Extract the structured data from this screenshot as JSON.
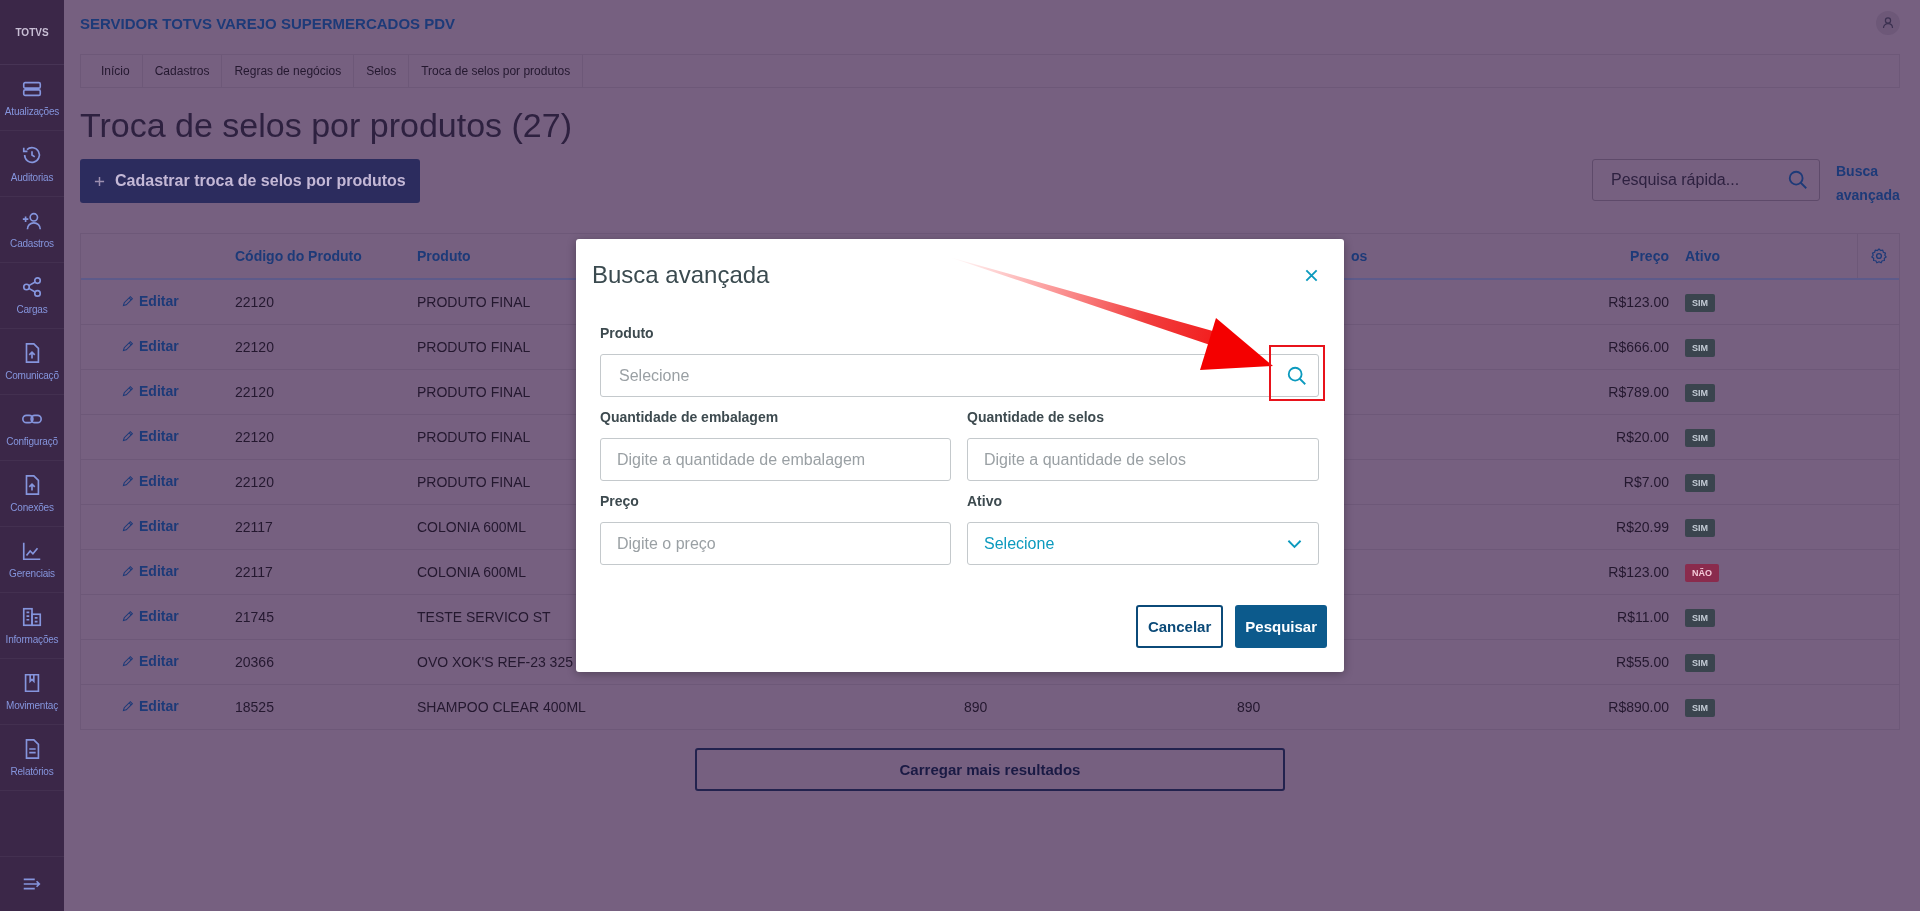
{
  "sidebar": {
    "logo": "TOTVS",
    "items": [
      {
        "label": "Atualizações"
      },
      {
        "label": "Auditorias"
      },
      {
        "label": "Cadastros"
      },
      {
        "label": "Cargas"
      },
      {
        "label": "Comunicaçõ"
      },
      {
        "label": "Configuraçõ"
      },
      {
        "label": "Conexões"
      },
      {
        "label": "Gerenciais"
      },
      {
        "label": "Informações"
      },
      {
        "label": "Movimentaç"
      },
      {
        "label": "Relatórios"
      }
    ]
  },
  "header": {
    "title": "SERVIDOR TOTVS VAREJO SUPERMERCADOS PDV"
  },
  "breadcrumb": [
    "Início",
    "Cadastros",
    "Regras de negócios",
    "Selos",
    "Troca de selos por produtos"
  ],
  "page_title": "Troca de selos por produtos (27)",
  "create_button": "Cadastrar troca de selos por produtos",
  "search": {
    "placeholder": "Pesquisa rápida...",
    "advanced_link": "Busca avançada"
  },
  "table": {
    "columns": {
      "code": "Código do Produto",
      "product": "Produto",
      "column_4": "os",
      "price": "Preço",
      "active": "Ativo"
    },
    "rows": [
      {
        "action": "Editar",
        "code": "22120",
        "product": "PRODUTO FINAL",
        "price": "R$123.00",
        "status": "SIM",
        "active": true
      },
      {
        "action": "Editar",
        "code": "22120",
        "product": "PRODUTO FINAL",
        "price": "R$666.00",
        "status": "SIM",
        "active": true
      },
      {
        "action": "Editar",
        "code": "22120",
        "product": "PRODUTO FINAL",
        "price": "R$789.00",
        "status": "SIM",
        "active": true
      },
      {
        "action": "Editar",
        "code": "22120",
        "product": "PRODUTO FINAL",
        "price": "R$20.00",
        "status": "SIM",
        "active": true
      },
      {
        "action": "Editar",
        "code": "22120",
        "product": "PRODUTO FINAL",
        "price": "R$7.00",
        "status": "SIM",
        "active": true
      },
      {
        "action": "Editar",
        "code": "22117",
        "product": "COLONIA 600ML",
        "price": "R$20.99",
        "status": "SIM",
        "active": true
      },
      {
        "action": "Editar",
        "code": "22117",
        "product": "COLONIA 600ML",
        "price": "R$123.00",
        "status": "NÃO",
        "active": false
      },
      {
        "action": "Editar",
        "code": "21745",
        "product": "TESTE SERVICO ST",
        "price": "R$11.00",
        "status": "SIM",
        "active": true
      },
      {
        "action": "Editar",
        "code": "20366",
        "product": "OVO XOK'S REF-23 325",
        "price": "R$55.00",
        "status": "SIM",
        "active": true
      },
      {
        "action": "Editar",
        "code": "18525",
        "product": "SHAMPOO CLEAR 400ML",
        "column_3": "890",
        "column_4": "890",
        "price": "R$890.00",
        "status": "SIM",
        "active": true
      }
    ]
  },
  "load_more": "Carregar mais resultados",
  "modal": {
    "title": "Busca avançada",
    "fields": [
      {
        "kind": "lookup",
        "label": "Produto",
        "placeholder": "Selecione"
      },
      {
        "kind": "text",
        "label": "Quantidade de embalagem",
        "placeholder": "Digite a quantidade de embalagem"
      },
      {
        "kind": "text",
        "label": "Quantidade de selos",
        "placeholder": "Digite a quantidade de selos"
      },
      {
        "kind": "text",
        "label": "Preço",
        "placeholder": "Digite o preço"
      },
      {
        "kind": "select",
        "label": "Ativo",
        "value": "Selecione"
      }
    ],
    "buttons": [
      {
        "kind": "secondary",
        "label": "Cancelar"
      },
      {
        "kind": "primary",
        "label": "Pesquisar"
      }
    ]
  }
}
